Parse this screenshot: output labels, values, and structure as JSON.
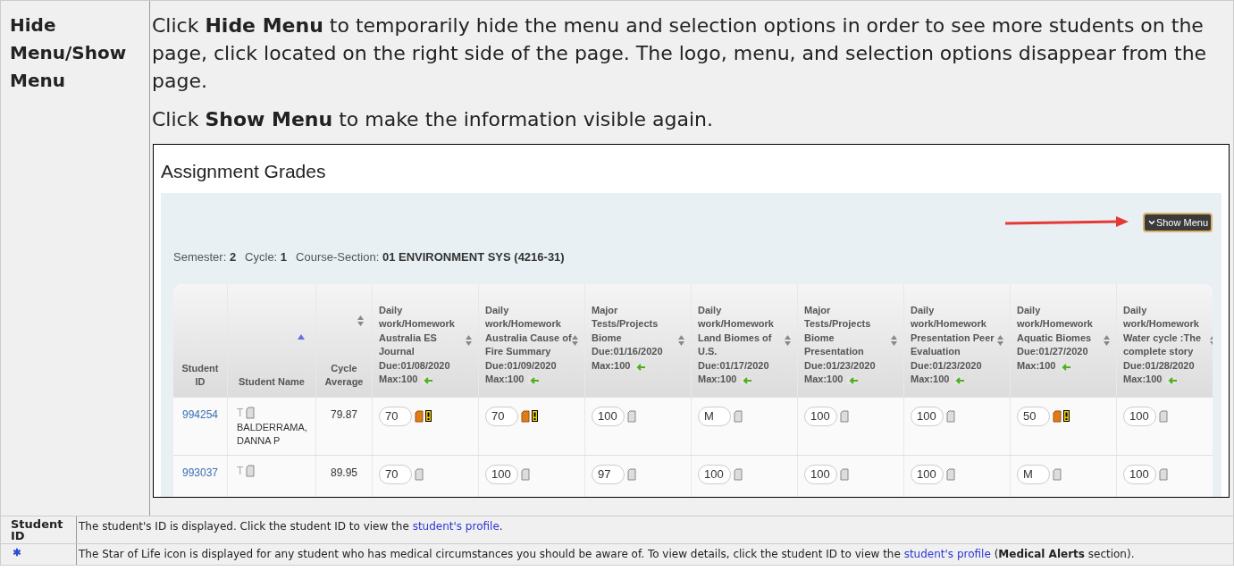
{
  "top_row": {
    "term": "Hide Menu/Show Menu",
    "paragraphs": [
      "Click **Hide Menu** to temporarily hide the menu and selection options in order to see more students on the page, click located on the right side of the page. The logo, menu, and selection options disappear from the page.",
      "Click **Show Menu** to make the information visible again."
    ],
    "screenshot": {
      "title": "Assignment Grades",
      "show_menu_button": "Show Menu",
      "filters": [
        {
          "label": "Semester:",
          "value": "2"
        },
        {
          "label": "Cycle:",
          "value": "1"
        },
        {
          "label": "Course-Section:",
          "value": "01 ENVIRONMENT SYS (4216-31)"
        }
      ],
      "columns": [
        {
          "kind": "id",
          "label": "Student\nID"
        },
        {
          "kind": "name",
          "label": "Student Name",
          "sorted": true
        },
        {
          "kind": "avg",
          "label": "Cycle\nAverage",
          "sorted": false
        },
        {
          "kind": "assignment",
          "label": "Daily\nwork/Homework\nAustralia ES\nJournal\nDue:01/08/2020\nMax:100",
          "sorted": false
        },
        {
          "kind": "assignment",
          "label": "Daily\nwork/Homework\nAustralia Cause of\nFire Summary\nDue:01/09/2020\nMax:100",
          "sorted": false
        },
        {
          "kind": "assignment",
          "label": "Major\nTests/Projects\nBiome\nDue:01/16/2020\nMax:100",
          "sorted": false
        },
        {
          "kind": "assignment",
          "label": "Daily\nwork/Homework\nLand Biomes of\nU.S.\nDue:01/17/2020\nMax:100",
          "sorted": false
        },
        {
          "kind": "assignment",
          "label": "Major\nTests/Projects\nBiome\nPresentation\nDue:01/23/2020\nMax:100",
          "sorted": false
        },
        {
          "kind": "assignment",
          "label": "Daily\nwork/Homework\nPresentation Peer\nEvaluation\nDue:01/23/2020\nMax:100",
          "sorted": false
        },
        {
          "kind": "assignment",
          "label": "Daily\nwork/Homework\nAquatic Biomes\nDue:01/27/2020\nMax:100",
          "sorted": false
        },
        {
          "kind": "assignment",
          "label": "Daily\nwork/Homework\nWater cycle :The\ncomplete story\nDue:01/28/2020\nMax:100",
          "sorted": false
        }
      ],
      "rows": [
        {
          "id": "994254",
          "flag": "T",
          "name": "BALDERRAMA,\nDANNA P",
          "average": "79.87",
          "grades": [
            {
              "value": "70",
              "alert": true
            },
            {
              "value": "70",
              "alert": true
            },
            {
              "value": "100",
              "alert": false
            },
            {
              "value": "M",
              "alert": false
            },
            {
              "value": "100",
              "alert": false
            },
            {
              "value": "100",
              "alert": false
            },
            {
              "value": "50",
              "alert": true
            },
            {
              "value": "100",
              "alert": false
            }
          ]
        },
        {
          "id": "993037",
          "flag": "T",
          "average": "89.95",
          "grades": [
            {
              "value": "70",
              "alert": false
            },
            {
              "value": "100",
              "alert": false
            },
            {
              "value": "97",
              "alert": false
            },
            {
              "value": "100",
              "alert": false
            },
            {
              "value": "100",
              "alert": false
            },
            {
              "value": "100",
              "alert": false
            },
            {
              "value": "M",
              "alert": false
            },
            {
              "value": "100",
              "alert": false
            }
          ]
        }
      ]
    }
  },
  "rows": [
    {
      "kind": "text",
      "term": "Student ID",
      "before": "The student's ID is displayed. Click the student ID to view the ",
      "link": "student's profile",
      "after": "."
    },
    {
      "kind": "icon",
      "before": "The Star of Life icon is displayed for any student who has medical circumstances you should be aware of. To view details, click the student ID to view the ",
      "link": "student's profile",
      "after": " (**Medical Alerts** section)."
    }
  ]
}
